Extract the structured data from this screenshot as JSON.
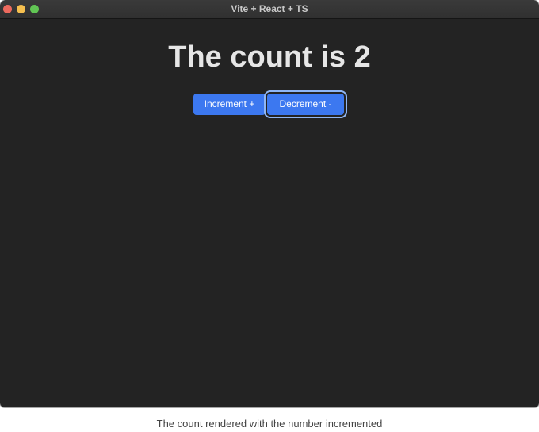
{
  "window": {
    "title": "Vite + React + TS"
  },
  "main": {
    "heading": "The count is 2",
    "increment_label": "Increment +",
    "decrement_label": "Decrement -"
  },
  "caption": "The count rendered with the number incremented",
  "colors": {
    "window_background": "#232323",
    "button_background": "#3c78f0",
    "focus_ring": "#8fb6f5"
  }
}
